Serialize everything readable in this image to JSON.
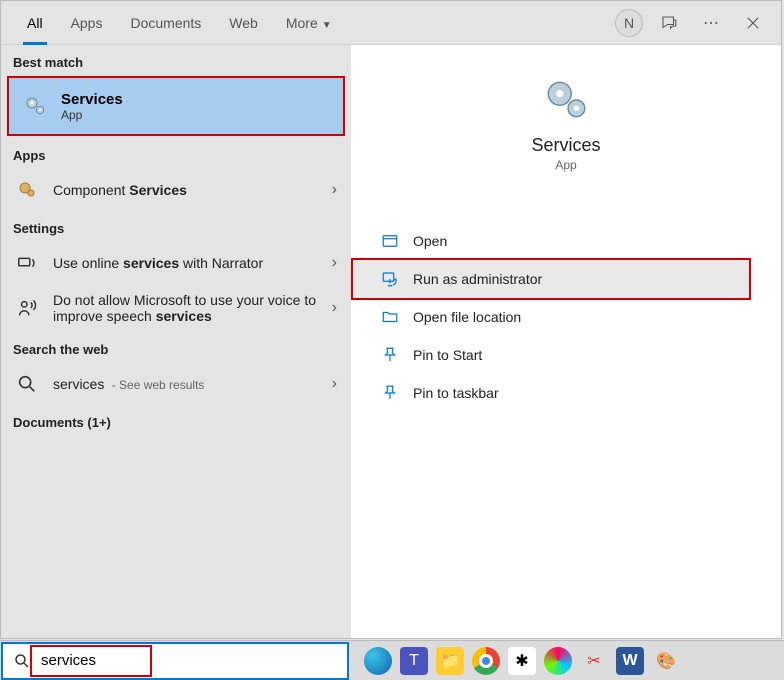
{
  "tabs": [
    "All",
    "Apps",
    "Documents",
    "Web",
    "More"
  ],
  "avatar": "N",
  "left": {
    "bestMatchHeader": "Best match",
    "best": {
      "title": "Services",
      "sub": "App"
    },
    "appsHeader": "Apps",
    "apps": [
      {
        "pre": "Component ",
        "bold": "Services"
      }
    ],
    "settingsHeader": "Settings",
    "settings": [
      {
        "pre": "Use online ",
        "bold": "services",
        "post": " with Narrator"
      },
      {
        "pre": "Do not allow Microsoft to use your voice to improve speech ",
        "bold": "services",
        "post": ""
      }
    ],
    "webHeader": "Search the web",
    "web": {
      "term": "services",
      "hint": " - See web results"
    },
    "docsHeader": "Documents (1+)"
  },
  "right": {
    "title": "Services",
    "sub": "App",
    "actions": [
      "Open",
      "Run as administrator",
      "Open file location",
      "Pin to Start",
      "Pin to taskbar"
    ]
  },
  "search": {
    "value": "services"
  }
}
